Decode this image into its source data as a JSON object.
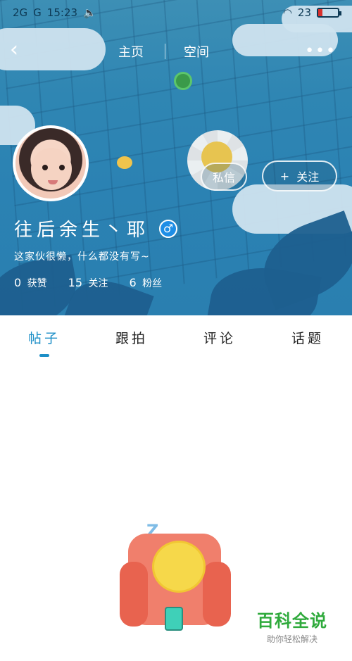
{
  "status_bar": {
    "signal_text": "2G",
    "signal_text2": "G",
    "time": "15:23",
    "battery_percent": "23",
    "battery_fraction": 0.23
  },
  "header": {
    "back_icon": "back-arrow-icon",
    "tabs": [
      "主页",
      "空间"
    ],
    "more_icon": "more-dots-icon"
  },
  "profile": {
    "username": "往后余生丶耶",
    "gender_symbol": "♂",
    "bio": "这家伙很懒，什么都没有写~",
    "stats": [
      {
        "value": "0",
        "label": "获赞"
      },
      {
        "value": "15",
        "label": "关注"
      },
      {
        "value": "6",
        "label": "粉丝"
      }
    ],
    "message_button": "私信",
    "follow_button_icon": "+",
    "follow_button": "关注"
  },
  "content_tabs": {
    "items": [
      "帖子",
      "跟拍",
      "评论",
      "话题"
    ],
    "active_index": 0
  },
  "watermark": {
    "title": "百科全说",
    "subtitle": "助你轻松解决"
  },
  "colors": {
    "accent": "#1c8fc7",
    "hero_blue": "#2f86b3",
    "watermark_green": "#2faa3c"
  }
}
